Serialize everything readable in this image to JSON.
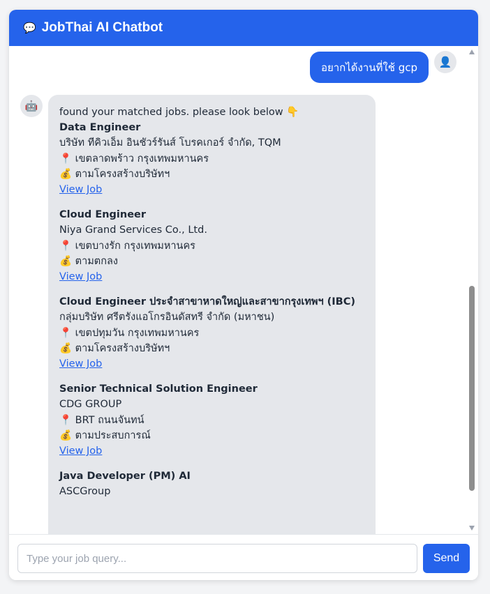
{
  "header": {
    "icon": "speech-bubble-icon",
    "title": "JobThai AI Chatbot"
  },
  "user_message": {
    "text": "อยากได้งานที่ใช้ gcp",
    "avatar_icon": "user-icon"
  },
  "bot_message": {
    "avatar_icon": "robot-icon",
    "intro": "found your matched jobs. please look below 👇",
    "jobs": [
      {
        "title": "Data Engineer",
        "company": "บริษัท ทีคิวเอ็ม อินชัวร์รันส์ โบรคเกอร์ จำกัด, TQM",
        "location": "📍 เขตลาดพร้าว กรุงเทพมหานคร",
        "salary": "💰 ตามโครงสร้างบริษัทฯ",
        "link_label": "View Job"
      },
      {
        "title": "Cloud Engineer",
        "company": "Niya Grand Services Co., Ltd.",
        "location": "📍 เขตบางรัก กรุงเทพมหานคร",
        "salary": "💰 ตามตกลง",
        "link_label": "View Job"
      },
      {
        "title": "Cloud Engineer ประจำสาขาหาดใหญ่และสาขากรุงเทพฯ (IBC)",
        "company": "กลุ่มบริษัท ศรีตรังแอโกรอินดัสทรี จำกัด (มหาชน)",
        "location": "📍 เขตปทุมวัน กรุงเทพมหานคร",
        "salary": "💰 ตามโครงสร้างบริษัทฯ",
        "link_label": "View Job"
      },
      {
        "title": "Senior Technical Solution Engineer",
        "company": "CDG GROUP",
        "location": "📍 BRT ถนนจันทน์",
        "salary": "💰 ตามประสบการณ์",
        "link_label": "View Job"
      },
      {
        "title": "Java Developer (PM) AI",
        "company": "ASCGroup",
        "location": "",
        "salary": "",
        "link_label": ""
      }
    ]
  },
  "footer": {
    "input_placeholder": "Type your job query...",
    "input_value": "",
    "send_label": "Send"
  },
  "colors": {
    "primary": "#2563eb",
    "bot_bubble": "#e5e7eb",
    "link": "#2563eb"
  }
}
